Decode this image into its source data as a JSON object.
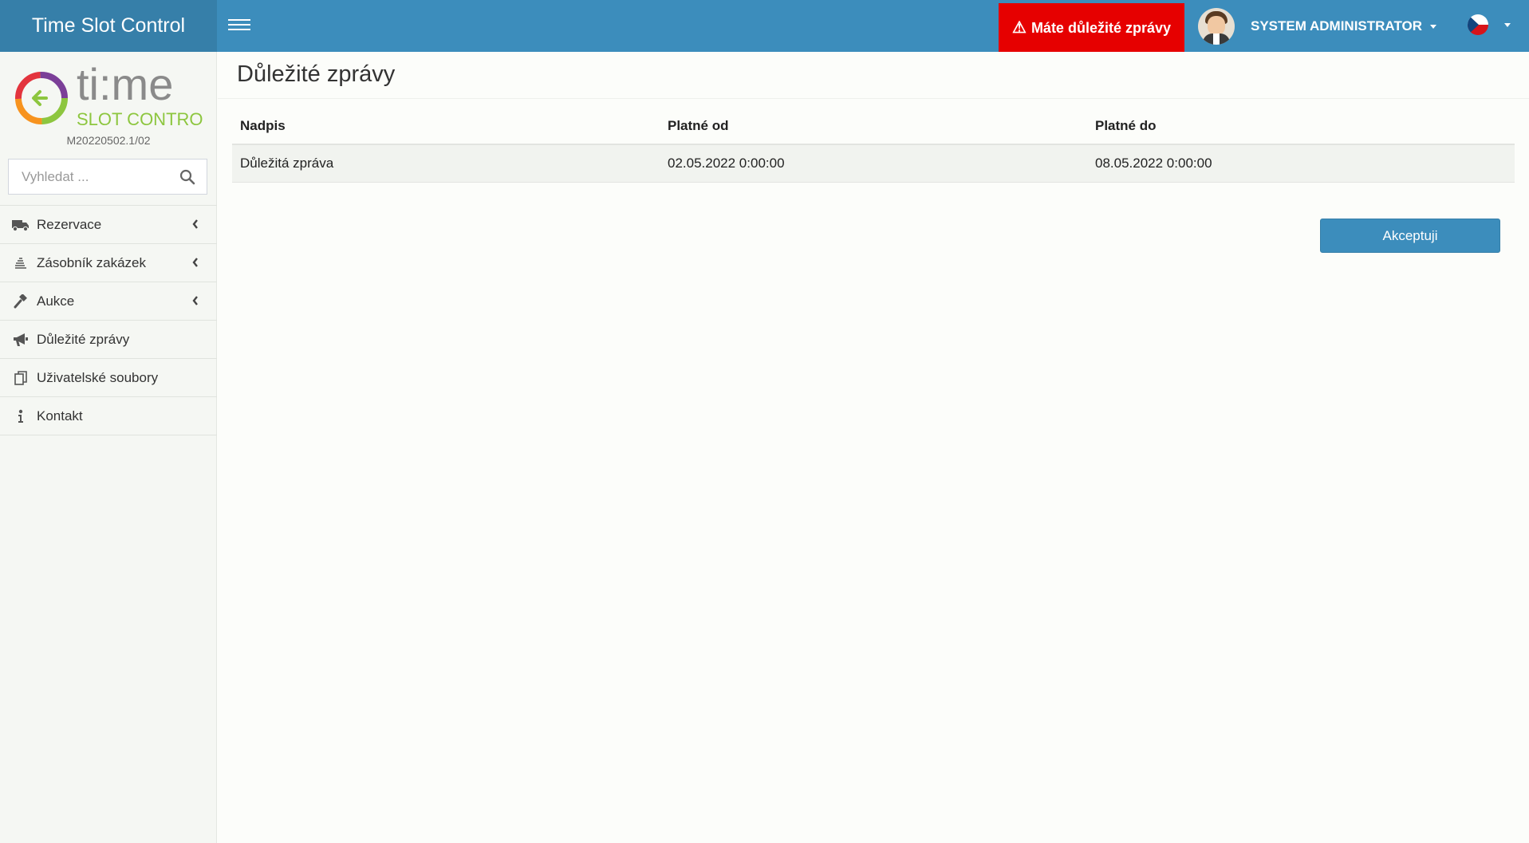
{
  "app": {
    "title": "Time Slot Control"
  },
  "navbar": {
    "alert_label": "Máte důležité zprávy",
    "user_name": "SYSTEM ADMINISTRATOR"
  },
  "sidebar": {
    "logo_text_main": "ti:me",
    "logo_text_sub": "SLOT CONTROL",
    "version": "M20220502.1/02",
    "search_placeholder": "Vyhledat ...",
    "items": [
      {
        "label": "Rezervace",
        "icon": "truck-icon",
        "expandable": true
      },
      {
        "label": "Zásobník zakázek",
        "icon": "stack-icon",
        "expandable": true
      },
      {
        "label": "Aukce",
        "icon": "gavel-icon",
        "expandable": true
      },
      {
        "label": "Důležité zprávy",
        "icon": "megaphone-icon",
        "expandable": false
      },
      {
        "label": "Uživatelské soubory",
        "icon": "files-icon",
        "expandable": false
      },
      {
        "label": "Kontakt",
        "icon": "info-icon",
        "expandable": false
      }
    ]
  },
  "main": {
    "page_title": "Důležité zprávy",
    "table": {
      "columns": [
        "Nadpis",
        "Platné od",
        "Platné do"
      ],
      "rows": [
        [
          "Důležitá zpráva",
          "02.05.2022 0:00:00",
          "08.05.2022 0:00:00"
        ]
      ]
    },
    "accept_button": "Akceptuji"
  },
  "colors": {
    "brand": "#367fa9",
    "navbar": "#3c8dbc",
    "alert": "#e60000",
    "logo_green": "#8dc63f"
  }
}
